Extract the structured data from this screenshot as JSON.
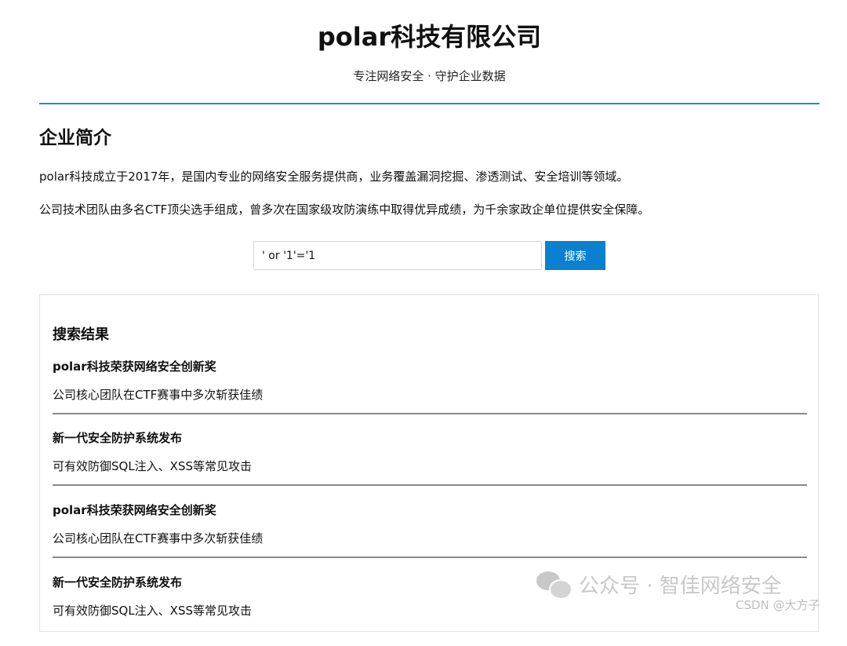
{
  "header": {
    "title": "polar科技有限公司",
    "subtitle": "专注网络安全 · 守护企业数据"
  },
  "intro": {
    "heading": "企业简介",
    "paragraphs": [
      "polar科技成立于2017年，是国内专业的网络安全服务提供商，业务覆盖漏洞挖掘、渗透测试、安全培训等领域。",
      "公司技术团队由多名CTF顶尖选手组成，曾多次在国家级攻防演练中取得优异成绩，为千余家政企单位提供安全保障。"
    ]
  },
  "search": {
    "value": "' or '1'='1",
    "button_label": "搜索"
  },
  "results": {
    "heading": "搜索结果",
    "items": [
      {
        "title": "polar科技荣获网络安全创新奖",
        "desc": "公司核心团队在CTF赛事中多次斩获佳绩"
      },
      {
        "title": "新一代安全防护系统发布",
        "desc": "可有效防御SQL注入、XSS等常见攻击"
      },
      {
        "title": "polar科技荣获网络安全创新奖",
        "desc": "公司核心团队在CTF赛事中多次斩获佳绩"
      },
      {
        "title": "新一代安全防护系统发布",
        "desc": "可有效防御SQL注入、XSS等常见攻击"
      }
    ]
  },
  "watermark": {
    "text": "公众号 · 智佳网络安全",
    "icon": "wechat-icon",
    "csdn": "CSDN @大方子"
  }
}
